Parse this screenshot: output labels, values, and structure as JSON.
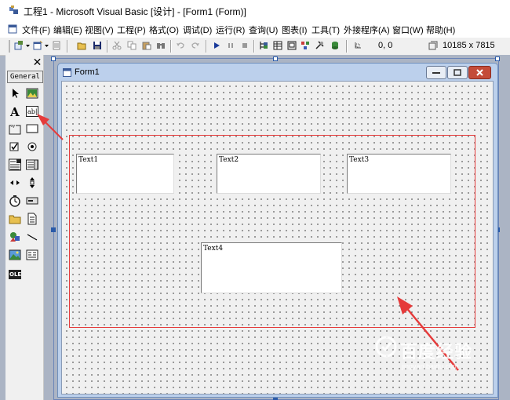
{
  "window": {
    "title": "工程1 - Microsoft Visual Basic [设计] - [Form1 (Form)]"
  },
  "menubar": {
    "items": [
      "文件(F)",
      "编辑(E)",
      "视图(V)",
      "工程(P)",
      "格式(O)",
      "调试(D)",
      "运行(R)",
      "查询(U)",
      "图表(I)",
      "工具(T)",
      "外接程序(A)",
      "窗口(W)",
      "帮助(H)"
    ]
  },
  "toolbar": {
    "position_readout": "0, 0",
    "size_readout": "10185 x 7815"
  },
  "toolbox": {
    "tab_label": "General",
    "close_glyph": "✕",
    "tools": [
      "pointer-icon",
      "picturebox-icon",
      "label-tool-icon",
      "textbox-tool-icon",
      "frame-icon",
      "commandbutton-icon",
      "checkbox-icon",
      "optionbutton-icon",
      "combobox-icon",
      "listbox-icon",
      "hscrollbar-icon",
      "vscrollbar-icon",
      "timer-icon",
      "drivelistbox-icon",
      "dirlistbox-icon",
      "filelistbox-icon",
      "shape-icon",
      "line-icon",
      "image-icon",
      "data-icon",
      "ole-icon"
    ],
    "ole_label": "OLE"
  },
  "form": {
    "caption": "Form1",
    "textboxes": [
      "Text1",
      "Text2",
      "Text3",
      "Text4"
    ]
  },
  "annotation": {
    "color": "#e53b3b"
  },
  "watermark": {
    "text": "百度经验",
    "url": "jingyan.baidu.com"
  }
}
